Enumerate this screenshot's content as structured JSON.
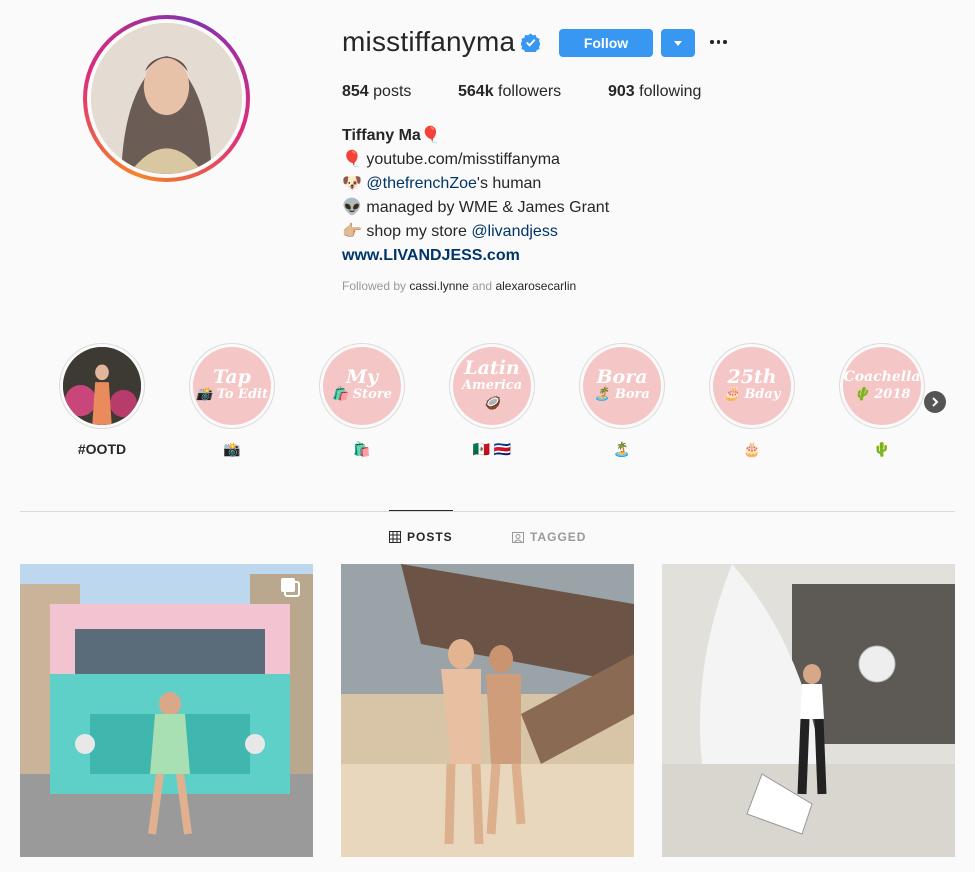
{
  "profile": {
    "username": "misstiffanyma",
    "follow_label": "Follow",
    "stats": {
      "posts": "854",
      "posts_label": "posts",
      "followers": "564k",
      "followers_label": "followers",
      "following": "903",
      "following_label": "following"
    },
    "bio": {
      "full_name": "Tiffany Ma",
      "full_name_emoji": "🎈",
      "line1_emoji": "🎈",
      "line1": "youtube.com/misstiffanyma",
      "line2_emoji": "🐶",
      "line2_mention": "@thefrenchZoe",
      "line2_rest": "'s human",
      "line3_emoji": "👽",
      "line3": "managed by WME & James Grant",
      "line4_emoji": "👉🏼",
      "line4_text": "shop my store ",
      "line4_mention": "@livandjess",
      "website": "www.LIVANDJESS.com"
    },
    "followed_by": {
      "prefix": "Followed by ",
      "user1": "cassi.lynne",
      "and": " and ",
      "user2": "alexarosecarlin"
    }
  },
  "highlights": [
    {
      "label": "#OOTD",
      "cover_text": "",
      "cover_small": ""
    },
    {
      "label": "📸",
      "cover_text": "Tap",
      "cover_small": "📸 To Edit"
    },
    {
      "label": "🛍️",
      "cover_text": "My",
      "cover_small": "🛍️ Store"
    },
    {
      "label": "🇲🇽 🇨🇷",
      "cover_text": "Latin",
      "cover_small": "America 🥥"
    },
    {
      "label": "🏝️",
      "cover_text": "Bora",
      "cover_small": "🏝️ Bora"
    },
    {
      "label": "🎂",
      "cover_text": "25th",
      "cover_small": "🎂 Bday"
    },
    {
      "label": "🌵",
      "cover_text": "Coachella",
      "cover_small": "🌵 2018"
    }
  ],
  "tabs": {
    "posts": "POSTS",
    "tagged": "TAGGED"
  },
  "colors": {
    "accent": "#3897f0",
    "link": "#003569",
    "highlight_bg": "#f5c6c6"
  }
}
